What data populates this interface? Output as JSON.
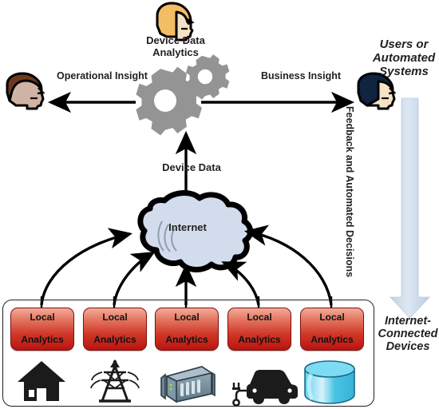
{
  "diagram": {
    "title_top_actor": "Device Data Analytics",
    "labels": {
      "operational_insight": "Operational Insight",
      "business_insight": "Business Insight",
      "device_data": "Device Data",
      "internet": "Internet",
      "users_or_automated_systems": "Users or Automated Systems",
      "feedback_and_automated_decisions": "Feedback and Automated Decisions",
      "internet_connected_devices": "Internet-Connected Devices"
    },
    "colors": {
      "cloud_fill": "#d3dcec",
      "cloud_outline": "#000000",
      "gear_gray": "#949494",
      "box_red_light": "#f3ab99",
      "box_red_dark": "#bb1410",
      "box_border": "#7d1210",
      "feedback_arrow": "#ccdaea",
      "hair_top": "#f3bd63",
      "hair_left": "#6b3a1e",
      "hair_right": "#10243f",
      "skin": "#f6e3c6",
      "database_cyan": "#49c8e8",
      "server_blue": "#6f8697",
      "text": "#231f20"
    },
    "actors": [
      {
        "name": "analytics-person",
        "icon": "person-head-blonde-icon"
      },
      {
        "name": "operations-person",
        "icon": "person-head-brown-icon"
      },
      {
        "name": "business-person",
        "icon": "person-head-dark-icon"
      }
    ],
    "gears": [
      {
        "name": "large-gear",
        "teeth": 10
      },
      {
        "name": "small-gear",
        "teeth": 8
      }
    ],
    "devices": [
      {
        "box_label_line1": "Local",
        "box_label_line2": "Analytics",
        "icon": "house-icon",
        "icon_name": "home"
      },
      {
        "box_label_line1": "Local",
        "box_label_line2": "Analytics",
        "icon": "power-tower-icon",
        "icon_name": "utility-grid"
      },
      {
        "box_label_line1": "Local",
        "box_label_line2": "Analytics",
        "icon": "server-icon",
        "icon_name": "server"
      },
      {
        "box_label_line1": "Local",
        "box_label_line2": "Analytics",
        "icon": "electric-car-icon",
        "icon_name": "electric-vehicle"
      },
      {
        "box_label_line1": "Local",
        "box_label_line2": "Analytics",
        "icon": "database-icon",
        "icon_name": "database"
      }
    ],
    "arrows": [
      {
        "name": "operational-insight-arrow",
        "direction": "left"
      },
      {
        "name": "business-insight-arrow",
        "direction": "right"
      },
      {
        "name": "device-data-arrow",
        "direction": "up"
      },
      {
        "name": "feedback-arrow",
        "direction": "down"
      }
    ]
  }
}
